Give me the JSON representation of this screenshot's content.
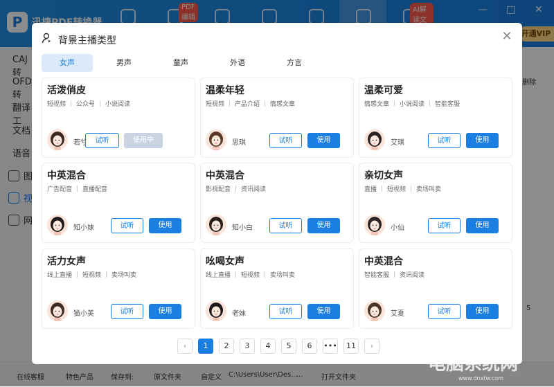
{
  "app": {
    "title": "迅捷PDF转换器",
    "badges": [
      "PDF编辑",
      "AI解读文档"
    ],
    "vip": "开通VIP",
    "window_controls": [
      "—",
      "□",
      "✕"
    ]
  },
  "sidebar": {
    "items": [
      "CAJ转",
      "OFD转",
      "翻译工",
      "文档",
      "语音",
      "图",
      "视",
      "网"
    ]
  },
  "right_panel": {
    "delete_label": "删除",
    "page_num": "5",
    "start_btn": "试听"
  },
  "bottom_bar": {
    "service": "在线客服",
    "featured": "特色产品",
    "save_to": "保存到:",
    "opt_source": "原文件夹",
    "opt_custom": "自定义",
    "path": "C:\\Users\\User\\Des...",
    "browse": "...",
    "open_folder": "打开文件夹"
  },
  "dialog": {
    "title": "背景主播类型",
    "close_icon": "close-icon",
    "tabs": [
      "女声",
      "男声",
      "童声",
      "外语",
      "方言"
    ],
    "active_tab": 0,
    "listen_label": "试听",
    "use_label": "使用",
    "in_use_label": "使用中",
    "cards": [
      {
        "title": "活泼俏皮",
        "tags": [
          "短视频",
          "公众号",
          "小说阅读"
        ],
        "name": "若兮",
        "in_use": true
      },
      {
        "title": "温柔年轻",
        "tags": [
          "短视频",
          "产品介绍",
          "情感文章"
        ],
        "name": "思琪",
        "in_use": false
      },
      {
        "title": "温柔可爱",
        "tags": [
          "情感文章",
          "小说阅读",
          "智能客服"
        ],
        "name": "艾琪",
        "in_use": false
      },
      {
        "title": "中英混合",
        "tags": [
          "广告配音",
          "直播配音"
        ],
        "name": "知小妹",
        "in_use": false
      },
      {
        "title": "中英混合",
        "tags": [
          "影视配音",
          "资讯阅读"
        ],
        "name": "知小白",
        "in_use": false
      },
      {
        "title": "亲切女声",
        "tags": [
          "直播",
          "短视频",
          "卖场叫卖"
        ],
        "name": "小仙",
        "in_use": false
      },
      {
        "title": "活力女声",
        "tags": [
          "线上直播",
          "短视频",
          "卖场叫卖"
        ],
        "name": "猫小美",
        "in_use": false
      },
      {
        "title": "吆喝女声",
        "tags": [
          "线上直播",
          "短视频",
          "卖场叫卖"
        ],
        "name": "老妹",
        "in_use": false
      },
      {
        "title": "中英混合",
        "tags": [
          "智能客服",
          "资讯阅读"
        ],
        "name": "艾夏",
        "in_use": false
      }
    ],
    "pagination": {
      "prev": "‹",
      "pages": [
        "1",
        "2",
        "3",
        "4",
        "5",
        "6",
        "•••",
        "11"
      ],
      "active": "1",
      "next": "›"
    }
  },
  "watermark": {
    "text": "电脑系统网",
    "url": "www.dnxtw.com"
  },
  "colors": {
    "primary": "#1a7fe0",
    "tab_active_bg": "#dbe9fb",
    "in_use_bg": "#c9d3e2"
  }
}
